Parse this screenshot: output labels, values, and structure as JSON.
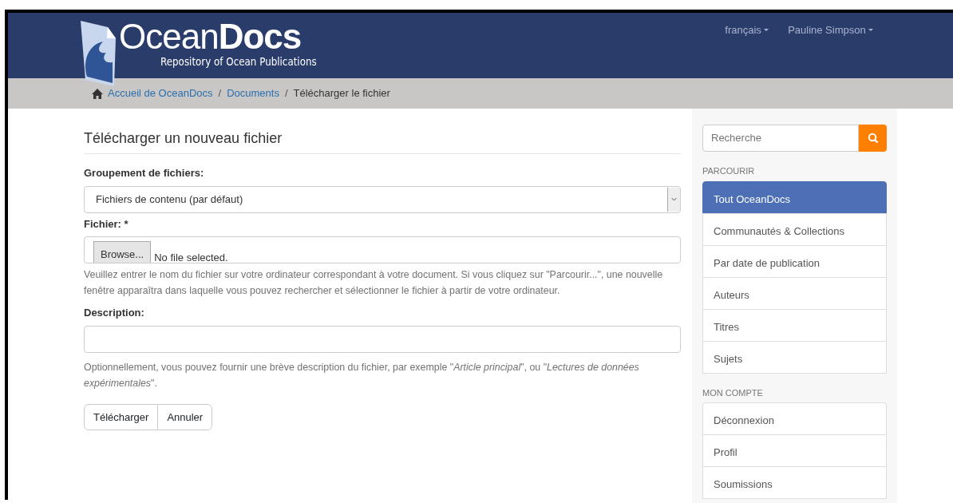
{
  "header": {
    "logo": {
      "name_light": "Ocean",
      "name_bold": "Docs",
      "tagline": "Repository of Ocean Publications"
    },
    "menus": [
      {
        "label": "français"
      },
      {
        "label": "Pauline Simpson"
      }
    ]
  },
  "breadcrumb": [
    {
      "label": "Accueil de OceanDocs",
      "kind": "home"
    },
    {
      "label": "/",
      "kind": "separator"
    },
    {
      "label": "Documents",
      "kind": "link"
    },
    {
      "label": "/",
      "kind": "separator"
    },
    {
      "label": "Télécharger le fichier",
      "kind": "current"
    }
  ],
  "form": {
    "title": "Télécharger un nouveau fichier",
    "fields": [
      {
        "kind": "select",
        "label": "Groupement de fichiers:",
        "value": "Fichiers de contenu (par défaut)"
      },
      {
        "kind": "file",
        "label": "Fichier: *",
        "button": "Browse...",
        "value": "No file selected.",
        "help": "Veuillez entrer le nom du fichier sur votre ordinateur correspondant à votre document. Si vous cliquez sur \"Parcourir...\", une nouvelle fenêtre apparaîtra dans laquelle vous pouvez rechercher et sélectionner le fichier à partir de votre ordinateur."
      },
      {
        "kind": "text",
        "label": "Description:",
        "help": "Optionnellement, vous pouvez fournir une brève description du fichier, par exemple \"*Article principal*\", ou \"*Lectures de données expérimentales*\"."
      }
    ],
    "buttons": [
      "Télécharger",
      "Annuler"
    ]
  },
  "sidebar": {
    "search": {
      "placeholder": "Recherche"
    },
    "sections": [
      {
        "heading": "PARCOURIR",
        "items": [
          {
            "label": "Tout OceanDocs",
            "selected": true
          },
          {
            "label": "Communautés & Collections",
            "selected": false
          },
          {
            "label": "Par date de publication",
            "selected": false
          },
          {
            "label": "Auteurs",
            "selected": false
          },
          {
            "label": "Titres",
            "selected": false
          },
          {
            "label": "Sujets",
            "selected": false
          }
        ]
      },
      {
        "heading": "MON COMPTE",
        "items": [
          {
            "label": "Déconnexion",
            "selected": false
          },
          {
            "label": "Profil",
            "selected": false
          },
          {
            "label": "Soumissions",
            "selected": false
          }
        ]
      }
    ]
  }
}
